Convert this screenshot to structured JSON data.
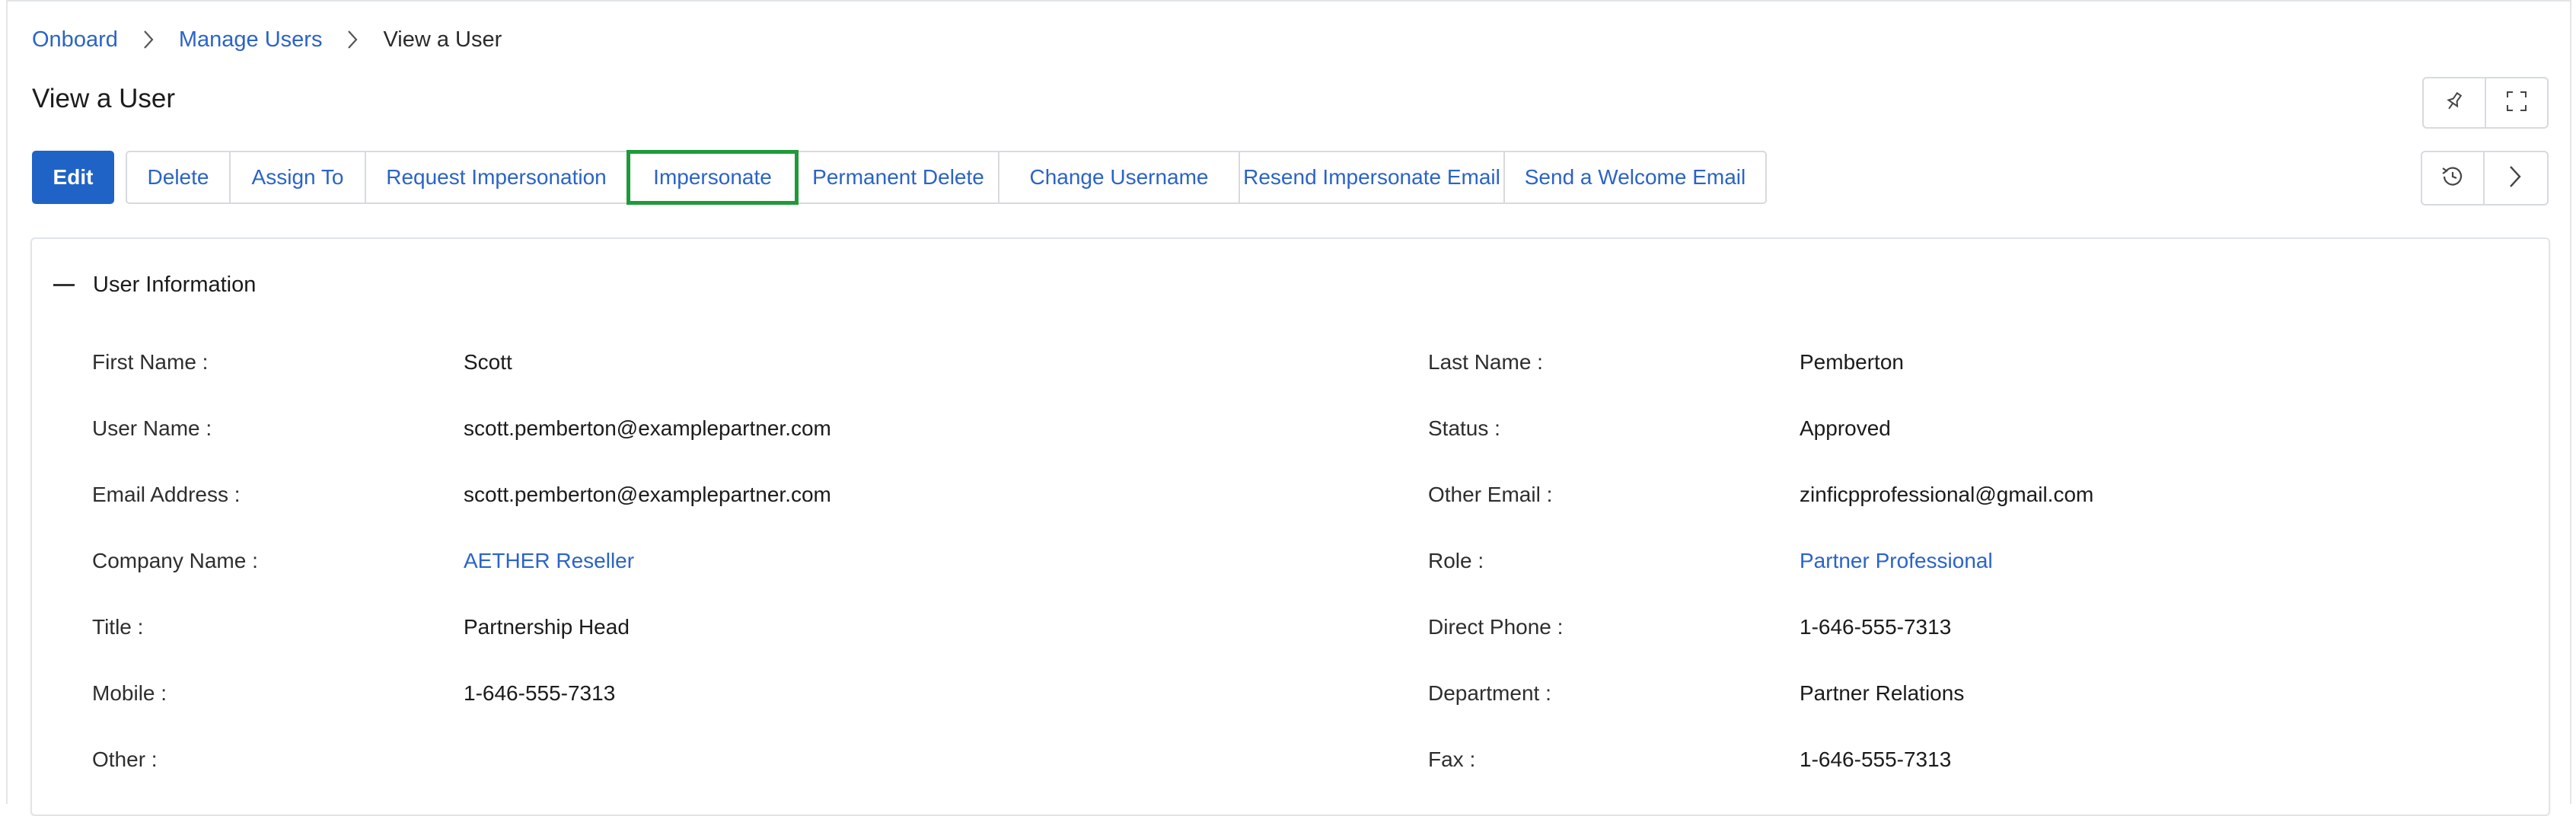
{
  "breadcrumb": {
    "items": [
      "Onboard",
      "Manage Users"
    ],
    "current": "View a User"
  },
  "page_title": "View a User",
  "toolbar": {
    "edit_label": "Edit",
    "buttons": [
      "Delete",
      "Assign To",
      "Request Impersonation",
      "Impersonate",
      "Permanent Delete",
      "Change Username",
      "Resend Impersonate Email",
      "Send a Welcome Email"
    ]
  },
  "section": {
    "title": "User Information"
  },
  "fields_left": [
    {
      "label": "First Name :",
      "value": "Scott"
    },
    {
      "label": "User Name :",
      "value": "scott.pemberton@examplepartner.com"
    },
    {
      "label": "Email Address :",
      "value": "scott.pemberton@examplepartner.com"
    },
    {
      "label": "Company Name :",
      "value": "AETHER Reseller"
    },
    {
      "label": "Title :",
      "value": "Partnership Head"
    },
    {
      "label": "Mobile :",
      "value": "1-646-555-7313"
    },
    {
      "label": "Other :",
      "value": ""
    }
  ],
  "fields_right": [
    {
      "label": "Last Name :",
      "value": "Pemberton"
    },
    {
      "label": "Status :",
      "value": "Approved"
    },
    {
      "label": "Other Email :",
      "value": "zinficpprofessional@gmail.com"
    },
    {
      "label": "Role :",
      "value": "Partner Professional"
    },
    {
      "label": "Direct Phone :",
      "value": "1-646-555-7313"
    },
    {
      "label": "Department :",
      "value": "Partner Relations"
    },
    {
      "label": "Fax :",
      "value": "1-646-555-7313"
    }
  ],
  "colors": {
    "link": "#2b63c8",
    "primary_button": "#1f63c6",
    "highlight_border": "#1f9a3a"
  },
  "icons": [
    "chevron-right-icon",
    "pin-icon",
    "expand-icon",
    "history-icon",
    "collapse-icon"
  ]
}
